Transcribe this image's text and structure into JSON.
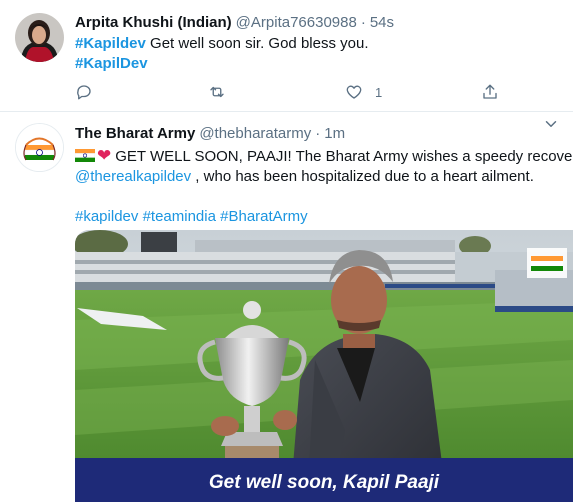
{
  "tweets": [
    {
      "name": "Arpita Khushi (Indian)",
      "handle": "@Arpita76630988",
      "separator": "·",
      "time": "54s",
      "hashtag1": "#Kapildev",
      "text1": " Get well soon sir. God bless you.",
      "hashtag2": "#KapilDev",
      "actions": {
        "reply_count": "",
        "retweet_count": "",
        "like_count": "1"
      }
    },
    {
      "name": "The Bharat Army",
      "handle": "@thebharatarmy",
      "separator": "·",
      "time": "1m",
      "line1": "GET WELL SOON, PAAJI! The Bharat Army wishes a speedy recovery to",
      "mention": "@therealkapildev",
      "line2_rest": " , who has been hospitalized due to a heart ailment.",
      "hashtags": [
        "#kapildev",
        "#teamindia",
        "#BharatArmy"
      ],
      "media": {
        "caption": "Get well soon, Kapil Paaji",
        "brand_color": "#1e2a78"
      }
    }
  ],
  "colors": {
    "link": "#1b95e0",
    "muted": "#5b7083",
    "divider": "#e6ecf0"
  },
  "icons": [
    "reply-icon",
    "retweet-icon",
    "like-icon",
    "share-icon",
    "caret-down-icon"
  ]
}
